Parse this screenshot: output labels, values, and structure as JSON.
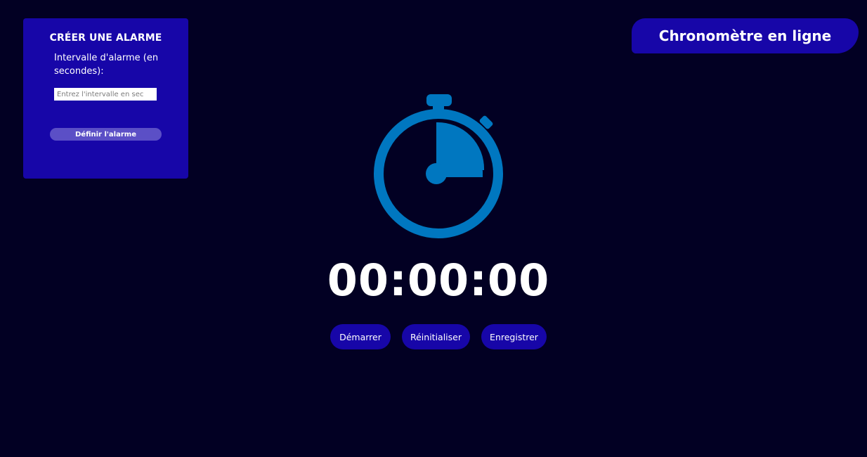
{
  "alarm": {
    "title": "CRÉER UNE ALARME",
    "interval_label": "Intervalle d'alarme (en secondes):",
    "interval_value": "",
    "interval_placeholder": "Entrez l'intervalle en sec",
    "set_button_label": "Définir l'alarme"
  },
  "header": {
    "title": "Chronomètre en ligne"
  },
  "stopwatch": {
    "icon": "stopwatch-icon",
    "time": "00:00:00"
  },
  "controls": {
    "start_label": "Démarrer",
    "reset_label": "Réinitialiser",
    "save_label": "Enregistrer"
  },
  "colors": {
    "background": "#020023",
    "panel": "#1706a8",
    "icon": "#0077c0",
    "alarm_button": "#5b4fc6"
  }
}
